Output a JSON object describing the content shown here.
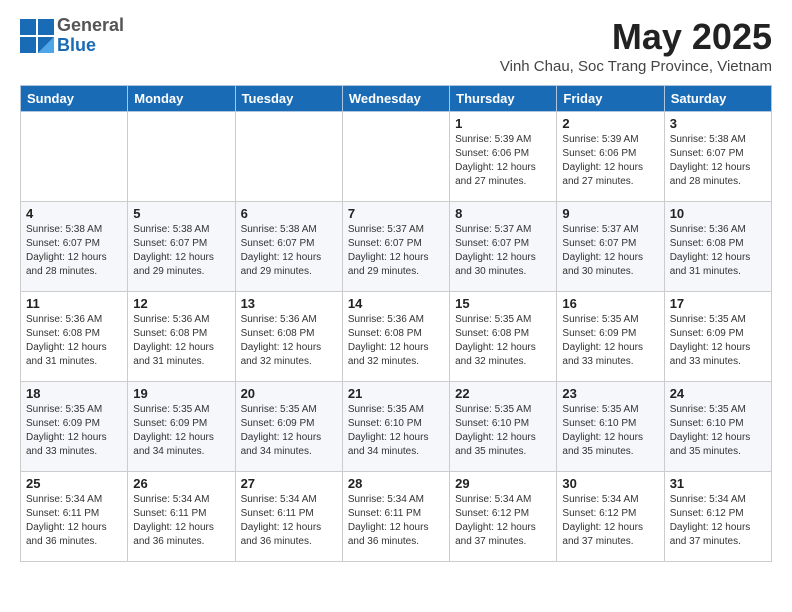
{
  "header": {
    "logo": {
      "line1": "General",
      "line2": "Blue"
    },
    "month": "May 2025",
    "location": "Vinh Chau, Soc Trang Province, Vietnam"
  },
  "weekdays": [
    "Sunday",
    "Monday",
    "Tuesday",
    "Wednesday",
    "Thursday",
    "Friday",
    "Saturday"
  ],
  "weeks": [
    [
      {
        "day": "",
        "info": ""
      },
      {
        "day": "",
        "info": ""
      },
      {
        "day": "",
        "info": ""
      },
      {
        "day": "",
        "info": ""
      },
      {
        "day": "1",
        "info": "Sunrise: 5:39 AM\nSunset: 6:06 PM\nDaylight: 12 hours\nand 27 minutes."
      },
      {
        "day": "2",
        "info": "Sunrise: 5:39 AM\nSunset: 6:06 PM\nDaylight: 12 hours\nand 27 minutes."
      },
      {
        "day": "3",
        "info": "Sunrise: 5:38 AM\nSunset: 6:07 PM\nDaylight: 12 hours\nand 28 minutes."
      }
    ],
    [
      {
        "day": "4",
        "info": "Sunrise: 5:38 AM\nSunset: 6:07 PM\nDaylight: 12 hours\nand 28 minutes."
      },
      {
        "day": "5",
        "info": "Sunrise: 5:38 AM\nSunset: 6:07 PM\nDaylight: 12 hours\nand 29 minutes."
      },
      {
        "day": "6",
        "info": "Sunrise: 5:38 AM\nSunset: 6:07 PM\nDaylight: 12 hours\nand 29 minutes."
      },
      {
        "day": "7",
        "info": "Sunrise: 5:37 AM\nSunset: 6:07 PM\nDaylight: 12 hours\nand 29 minutes."
      },
      {
        "day": "8",
        "info": "Sunrise: 5:37 AM\nSunset: 6:07 PM\nDaylight: 12 hours\nand 30 minutes."
      },
      {
        "day": "9",
        "info": "Sunrise: 5:37 AM\nSunset: 6:07 PM\nDaylight: 12 hours\nand 30 minutes."
      },
      {
        "day": "10",
        "info": "Sunrise: 5:36 AM\nSunset: 6:08 PM\nDaylight: 12 hours\nand 31 minutes."
      }
    ],
    [
      {
        "day": "11",
        "info": "Sunrise: 5:36 AM\nSunset: 6:08 PM\nDaylight: 12 hours\nand 31 minutes."
      },
      {
        "day": "12",
        "info": "Sunrise: 5:36 AM\nSunset: 6:08 PM\nDaylight: 12 hours\nand 31 minutes."
      },
      {
        "day": "13",
        "info": "Sunrise: 5:36 AM\nSunset: 6:08 PM\nDaylight: 12 hours\nand 32 minutes."
      },
      {
        "day": "14",
        "info": "Sunrise: 5:36 AM\nSunset: 6:08 PM\nDaylight: 12 hours\nand 32 minutes."
      },
      {
        "day": "15",
        "info": "Sunrise: 5:35 AM\nSunset: 6:08 PM\nDaylight: 12 hours\nand 32 minutes."
      },
      {
        "day": "16",
        "info": "Sunrise: 5:35 AM\nSunset: 6:09 PM\nDaylight: 12 hours\nand 33 minutes."
      },
      {
        "day": "17",
        "info": "Sunrise: 5:35 AM\nSunset: 6:09 PM\nDaylight: 12 hours\nand 33 minutes."
      }
    ],
    [
      {
        "day": "18",
        "info": "Sunrise: 5:35 AM\nSunset: 6:09 PM\nDaylight: 12 hours\nand 33 minutes."
      },
      {
        "day": "19",
        "info": "Sunrise: 5:35 AM\nSunset: 6:09 PM\nDaylight: 12 hours\nand 34 minutes."
      },
      {
        "day": "20",
        "info": "Sunrise: 5:35 AM\nSunset: 6:09 PM\nDaylight: 12 hours\nand 34 minutes."
      },
      {
        "day": "21",
        "info": "Sunrise: 5:35 AM\nSunset: 6:10 PM\nDaylight: 12 hours\nand 34 minutes."
      },
      {
        "day": "22",
        "info": "Sunrise: 5:35 AM\nSunset: 6:10 PM\nDaylight: 12 hours\nand 35 minutes."
      },
      {
        "day": "23",
        "info": "Sunrise: 5:35 AM\nSunset: 6:10 PM\nDaylight: 12 hours\nand 35 minutes."
      },
      {
        "day": "24",
        "info": "Sunrise: 5:35 AM\nSunset: 6:10 PM\nDaylight: 12 hours\nand 35 minutes."
      }
    ],
    [
      {
        "day": "25",
        "info": "Sunrise: 5:34 AM\nSunset: 6:11 PM\nDaylight: 12 hours\nand 36 minutes."
      },
      {
        "day": "26",
        "info": "Sunrise: 5:34 AM\nSunset: 6:11 PM\nDaylight: 12 hours\nand 36 minutes."
      },
      {
        "day": "27",
        "info": "Sunrise: 5:34 AM\nSunset: 6:11 PM\nDaylight: 12 hours\nand 36 minutes."
      },
      {
        "day": "28",
        "info": "Sunrise: 5:34 AM\nSunset: 6:11 PM\nDaylight: 12 hours\nand 36 minutes."
      },
      {
        "day": "29",
        "info": "Sunrise: 5:34 AM\nSunset: 6:12 PM\nDaylight: 12 hours\nand 37 minutes."
      },
      {
        "day": "30",
        "info": "Sunrise: 5:34 AM\nSunset: 6:12 PM\nDaylight: 12 hours\nand 37 minutes."
      },
      {
        "day": "31",
        "info": "Sunrise: 5:34 AM\nSunset: 6:12 PM\nDaylight: 12 hours\nand 37 minutes."
      }
    ]
  ]
}
